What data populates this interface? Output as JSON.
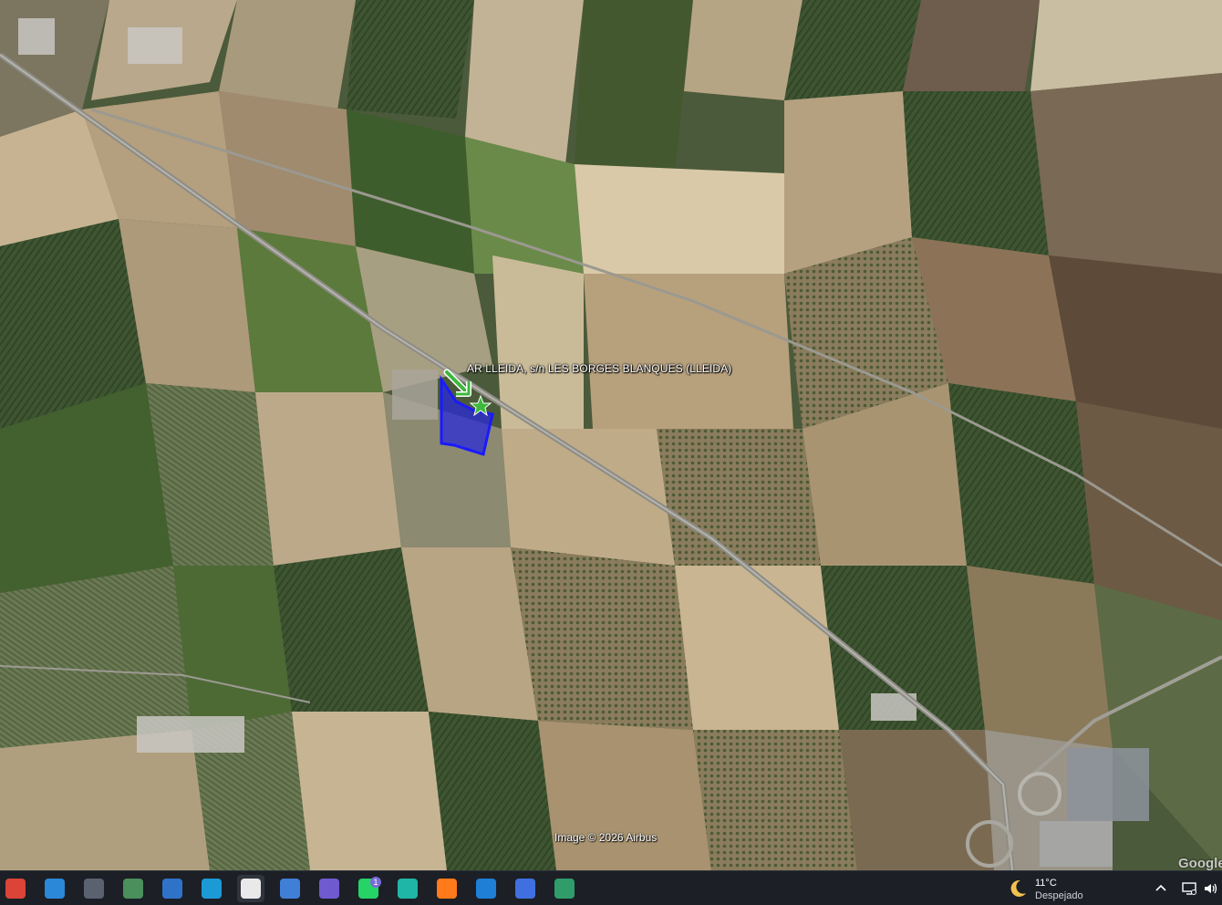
{
  "map": {
    "place_label": "AR LLEIDA, s/n LES BORGES BLANQUES (LLEIDA)",
    "attribution": "Image © 2026 Airbus",
    "logo_text": "Google",
    "highlight_color": "#1a1aff",
    "marker_color": "#3db83d",
    "icons": [
      "arrow-icon",
      "star-icon"
    ]
  },
  "taskbar": {
    "apps": [
      {
        "name": "chrome-icon",
        "badge": "",
        "color": "#db4437"
      },
      {
        "name": "photos-icon",
        "badge": "",
        "color": "#2b88d8"
      },
      {
        "name": "screen-capture-icon",
        "badge": "",
        "color": "#5a6270"
      },
      {
        "name": "lock-app-icon",
        "badge": "",
        "color": "#4a8f5c"
      },
      {
        "name": "photos-viewer-icon",
        "badge": "",
        "color": "#2f73c8"
      },
      {
        "name": "edge-icon",
        "badge": "",
        "color": "#1c9ad6"
      },
      {
        "name": "file-icon",
        "badge": "",
        "color": "#e9e9e9"
      },
      {
        "name": "google-earth-icon",
        "badge": "",
        "color": "#3f7fd6"
      },
      {
        "name": "save-disk-icon",
        "badge": "",
        "color": "#6f5ad0"
      },
      {
        "name": "whatsapp-icon",
        "badge": "1",
        "color": "#25d366"
      },
      {
        "name": "cast-app-icon",
        "badge": "",
        "color": "#1fb6a7"
      },
      {
        "name": "firefox-icon",
        "badge": "",
        "color": "#ff7a1a"
      },
      {
        "name": "dollar-app-icon",
        "badge": "",
        "color": "#1f7fd6"
      },
      {
        "name": "arc-app-icon",
        "badge": "",
        "color": "#3f6fe0"
      },
      {
        "name": "window-app-icon",
        "badge": "",
        "color": "#2f9c6a"
      }
    ],
    "weather": {
      "temperature": "11°C",
      "condition": "Despejado"
    },
    "tray": [
      "chevron-up-icon",
      "network-icon",
      "volume-icon"
    ]
  }
}
